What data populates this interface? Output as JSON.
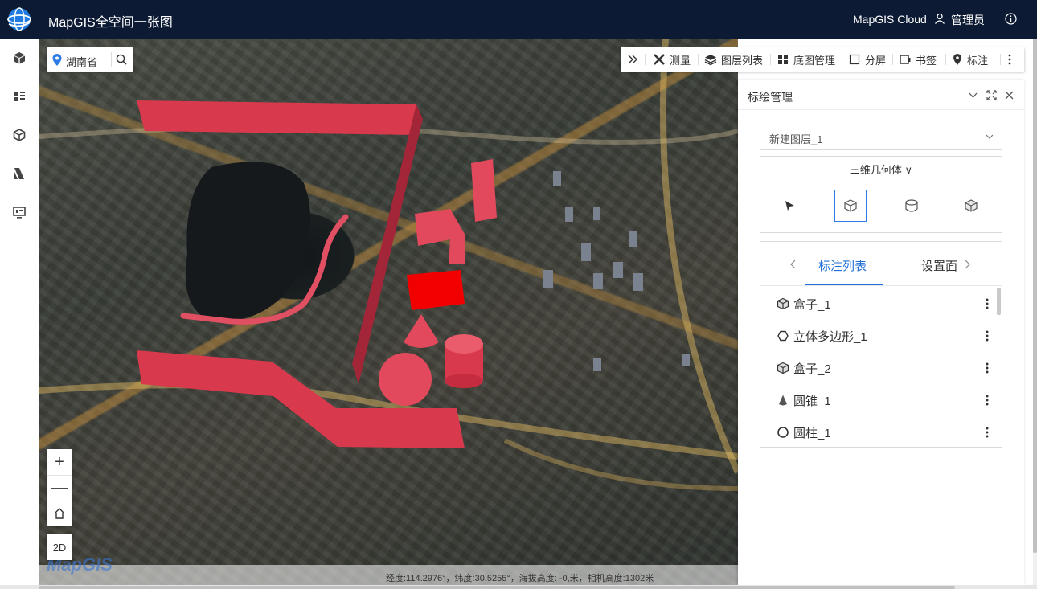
{
  "header": {
    "title": "MapGIS全空间一张图",
    "cloud_label": "MapGIS Cloud",
    "user_name": "管理员"
  },
  "leftnav": {
    "items": [
      "cube-icon",
      "layers-panel-icon",
      "box3d-icon",
      "analysis-icon",
      "screen-icon"
    ]
  },
  "search": {
    "location": "湖南省"
  },
  "toolbar": {
    "items": [
      {
        "label": "测量",
        "icon": "ruler-icon"
      },
      {
        "label": "图层列表",
        "icon": "layers-icon"
      },
      {
        "label": "底图管理",
        "icon": "grid-icon"
      },
      {
        "label": "分屏",
        "icon": "split-icon"
      },
      {
        "label": "书签",
        "icon": "bookmark-icon"
      },
      {
        "label": "标注",
        "icon": "pin-icon"
      }
    ]
  },
  "map": {
    "coords": "经度:114.2976°，纬度:30.5255°，海拔高度: -0,米，相机高度:1302米",
    "watermark": "MapGIS",
    "btn_2d": "2D",
    "zoom_in": "+",
    "zoom_out": "—"
  },
  "panel": {
    "title": "标绘管理",
    "layer_select": "新建图层_1",
    "geometry_type": "三维几何体 ∨",
    "tabs": [
      "标注列表",
      "设置面"
    ],
    "active_tab": "标注列表",
    "list": [
      {
        "label": "盒子_1",
        "icon": "box-icon"
      },
      {
        "label": "立体多边形_1",
        "icon": "polygon-icon"
      },
      {
        "label": "盒子_2",
        "icon": "box-icon"
      },
      {
        "label": "圆锥_1",
        "icon": "cone-icon"
      },
      {
        "label": "圆柱_1",
        "icon": "cylinder-icon"
      }
    ]
  },
  "colors": {
    "header_bg": "#0c1a33",
    "accent": "#1f6fd6",
    "shape_red": "#d8394d"
  }
}
